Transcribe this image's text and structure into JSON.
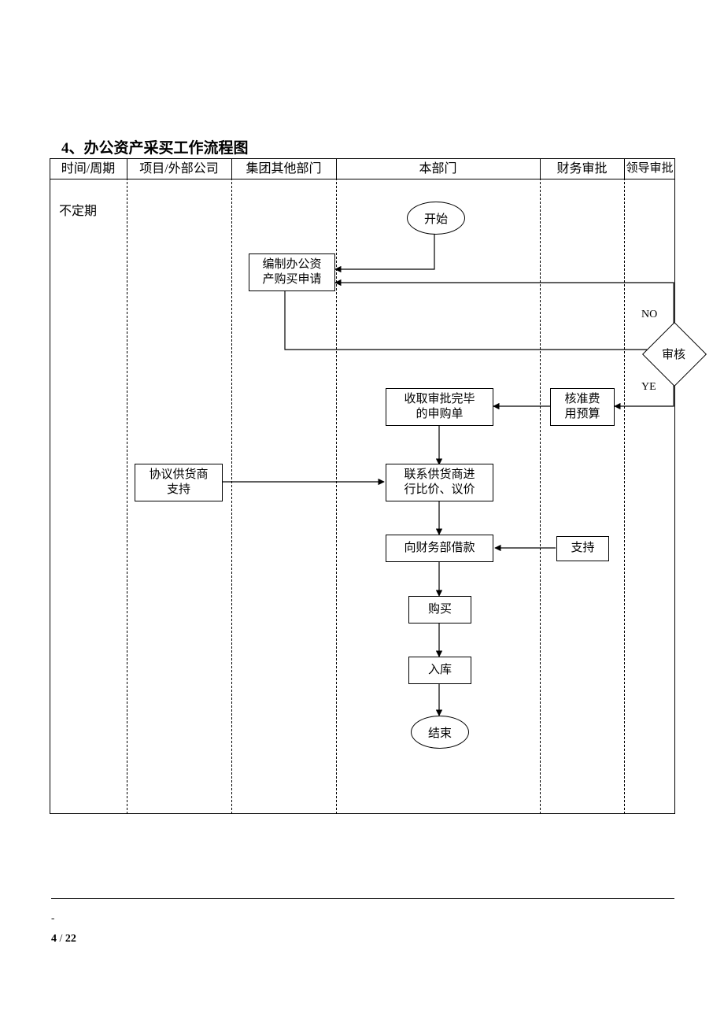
{
  "title": "4、办公资产采买工作流程图",
  "columns": [
    "时间/周期",
    "项目/外部公司",
    "集团其他部门",
    "本部门",
    "财务审批",
    "领导审批"
  ],
  "period": "不定期",
  "nodes": {
    "start": "开始",
    "compile": "编制办公资\n产购买申请",
    "audit": "审核",
    "no": "NO",
    "yes": "YE",
    "budget": "核准费\n用预算",
    "collect": "收取审批完毕\n的申购单",
    "supplier_support": "协议供货商\n支持",
    "contact": "联系供货商进\n行比价、议价",
    "borrow": "向财务部借款",
    "support": "支持",
    "buy": "购买",
    "stock": "入库",
    "end": "结束"
  },
  "page": {
    "current": "4",
    "total": "22",
    "sep": " / "
  }
}
